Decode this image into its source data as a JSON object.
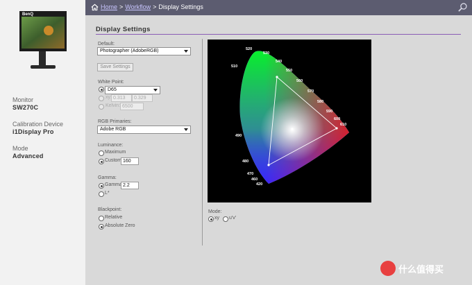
{
  "header": {
    "crumbs": [
      "Home",
      "Workflow"
    ],
    "separator": ">",
    "current": "Display Settings"
  },
  "sidebar": {
    "monitor_label": "Monitor",
    "monitor_value": "SW270C",
    "device_label": "Calibration Device",
    "device_value": "i1Display Pro",
    "mode_label": "Mode",
    "mode_value": "Advanced"
  },
  "main": {
    "title": "Display Settings",
    "default_label": "Default:",
    "default_value": "Photographer (AdobeRGB)",
    "save_label": "Save Settings",
    "whitepoint_label": "White Point:",
    "whitepoint_value": "D65",
    "xy_label": "xy:",
    "x_value": "0.313",
    "y_value": "0.329",
    "kelvin_label": "Kelvin:",
    "kelvin_value": "6500",
    "primaries_label": "RGB Primaries:",
    "primaries_value": "Adobe RGB",
    "luminance_label": "Luminance:",
    "lum_max_label": "Maximum",
    "lum_custom_label": "Custom",
    "lum_custom_value": "160",
    "gamma_label": "Gamma:",
    "gamma_option_label": "Gamma",
    "gamma_value": "2.2",
    "lstar_label": "L*",
    "blackpoint_label": "Blackpoint:",
    "bp_relative_label": "Relative",
    "bp_absolute_label": "Absolute Zero",
    "mode_label": "Mode:",
    "mode_xy_label": "xy",
    "mode_uv_label": "u'v'"
  },
  "chromaticity": {
    "wavelength_labels": [
      "520",
      "530",
      "540",
      "550",
      "510",
      "560",
      "570",
      "580",
      "590",
      "600",
      "610",
      "490",
      "480",
      "470",
      "460",
      "420"
    ]
  },
  "watermark": {
    "text": "什么值得买"
  }
}
